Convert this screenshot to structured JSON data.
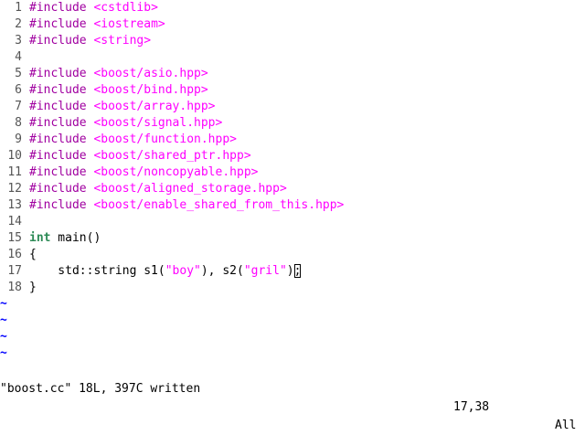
{
  "editor": {
    "lines": [
      {
        "num": "1",
        "parts": [
          {
            "t": "#include ",
            "c": "pre"
          },
          {
            "t": "<cstdlib>",
            "c": "inc"
          }
        ]
      },
      {
        "num": "2",
        "parts": [
          {
            "t": "#include ",
            "c": "pre"
          },
          {
            "t": "<iostream>",
            "c": "inc"
          }
        ]
      },
      {
        "num": "3",
        "parts": [
          {
            "t": "#include ",
            "c": "pre"
          },
          {
            "t": "<string>",
            "c": "inc"
          }
        ]
      },
      {
        "num": "4",
        "parts": []
      },
      {
        "num": "5",
        "parts": [
          {
            "t": "#include ",
            "c": "pre"
          },
          {
            "t": "<boost/asio.hpp>",
            "c": "inc"
          }
        ]
      },
      {
        "num": "6",
        "parts": [
          {
            "t": "#include ",
            "c": "pre"
          },
          {
            "t": "<boost/bind.hpp>",
            "c": "inc"
          }
        ]
      },
      {
        "num": "7",
        "parts": [
          {
            "t": "#include ",
            "c": "pre"
          },
          {
            "t": "<boost/array.hpp>",
            "c": "inc"
          }
        ]
      },
      {
        "num": "8",
        "parts": [
          {
            "t": "#include ",
            "c": "pre"
          },
          {
            "t": "<boost/signal.hpp>",
            "c": "inc"
          }
        ]
      },
      {
        "num": "9",
        "parts": [
          {
            "t": "#include ",
            "c": "pre"
          },
          {
            "t": "<boost/function.hpp>",
            "c": "inc"
          }
        ]
      },
      {
        "num": "10",
        "parts": [
          {
            "t": "#include ",
            "c": "pre"
          },
          {
            "t": "<boost/shared_ptr.hpp>",
            "c": "inc"
          }
        ]
      },
      {
        "num": "11",
        "parts": [
          {
            "t": "#include ",
            "c": "pre"
          },
          {
            "t": "<boost/noncopyable.hpp>",
            "c": "inc"
          }
        ]
      },
      {
        "num": "12",
        "parts": [
          {
            "t": "#include ",
            "c": "pre"
          },
          {
            "t": "<boost/aligned_storage.hpp>",
            "c": "inc"
          }
        ]
      },
      {
        "num": "13",
        "parts": [
          {
            "t": "#include ",
            "c": "pre"
          },
          {
            "t": "<boost/enable_shared_from_this.hpp>",
            "c": "inc"
          }
        ]
      },
      {
        "num": "14",
        "parts": []
      },
      {
        "num": "15",
        "parts": [
          {
            "t": "int",
            "c": "kw"
          },
          {
            "t": " main()",
            "c": "plain"
          }
        ]
      },
      {
        "num": "16",
        "parts": [
          {
            "t": "{",
            "c": "plain"
          }
        ]
      },
      {
        "num": "17",
        "parts": [
          {
            "t": "    std::string s1(",
            "c": "plain"
          },
          {
            "t": "\"boy\"",
            "c": "str"
          },
          {
            "t": "), s2(",
            "c": "plain"
          },
          {
            "t": "\"gril\"",
            "c": "str"
          },
          {
            "t": ")",
            "c": "plain"
          },
          {
            "t": ";",
            "c": "plain cursor"
          }
        ]
      },
      {
        "num": "18",
        "parts": [
          {
            "t": "}",
            "c": "plain"
          }
        ]
      }
    ],
    "tildes": [
      "~",
      "~",
      "~",
      "~"
    ]
  },
  "status": {
    "message": "\"boost.cc\" 18L, 397C written",
    "position": "17,38",
    "percent": "All"
  }
}
